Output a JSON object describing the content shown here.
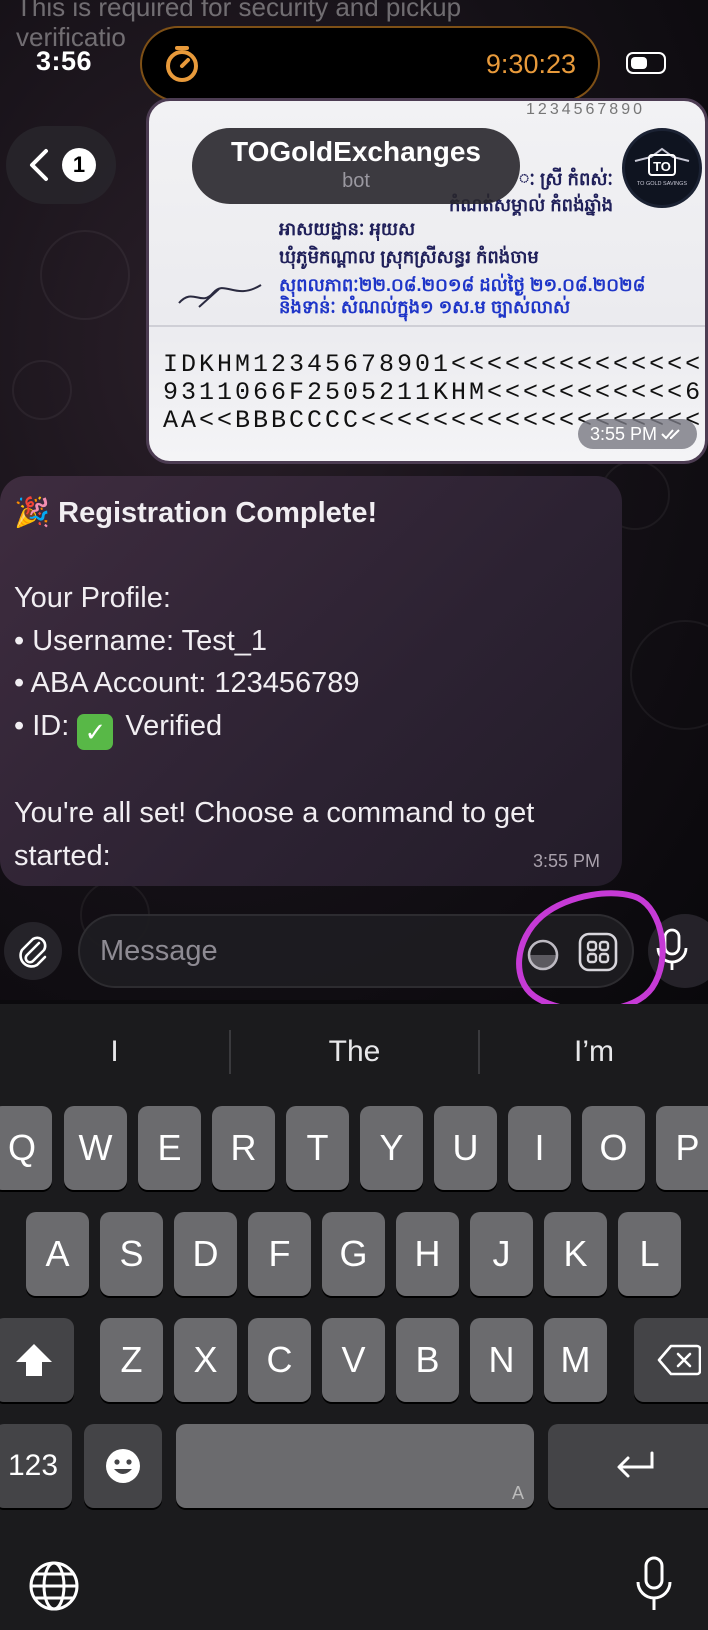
{
  "previous_message": {
    "line1": "This is required for security and pickup",
    "line2": "verificatio"
  },
  "status_bar": {
    "time": "3:56",
    "timer": "9:30:23",
    "timer_icon": "stopwatch-icon",
    "battery_icon": "battery-icon"
  },
  "header": {
    "back_badge": "1",
    "title": "TOGoldExchanges",
    "subtitle": "bot",
    "avatar_text": "TO",
    "avatar_subtext": "TO GOLD SAVINGS"
  },
  "id_card": {
    "top_number": "1234567890",
    "khmer_lines": [
      "ៈ ស្រី   កំពស់ៈ",
      "កំណត់សម្គាល់ កំពង់ឆ្នាំង",
      "អាសយដ្ឋានៈ អុយស",
      "ឃុំភូមិ​កណ្តាល ស្រុកស្រីសន្ធរ កំពង់ចាម",
      "សុពលភាពៈ២២.០៨.២០១៨ ដល់ថ្ងៃ ២១.០៨.២០២៨",
      "និងទាន់ៈ   សំណល់ក្នុង១ ១ស.ម ច្បាស់លាស់"
    ],
    "mrz": [
      "IDKHM12345678901<<<<<<<<<<<<<<",
      "9311066F2505211KHM<<<<<<<<<<<6",
      "AA<<BBBCCCC<<<<<<<<<<<<<<<<<<<"
    ],
    "time": "3:55 PM"
  },
  "bot_message": {
    "heading": "Registration Complete!",
    "profile_label": "Your Profile:",
    "username_line": "• Username: Test_1",
    "aba_line": "• ABA Account: 123456789",
    "id_prefix": "• ID:",
    "id_status": "Verified",
    "closing_line1": "You're all set! Choose a command to get",
    "closing_line2": "started:",
    "time": "3:55 PM"
  },
  "composer": {
    "placeholder": "Message"
  },
  "keyboard": {
    "suggestions": [
      "I",
      "The",
      "I’m"
    ],
    "row1": [
      "Q",
      "W",
      "E",
      "R",
      "T",
      "Y",
      "U",
      "I",
      "O",
      "P"
    ],
    "row2": [
      "A",
      "S",
      "D",
      "F",
      "G",
      "H",
      "J",
      "K",
      "L"
    ],
    "row3": [
      "Z",
      "X",
      "C",
      "V",
      "B",
      "N",
      "M"
    ],
    "numbers_key": "123",
    "space_hint": "A"
  },
  "colors": {
    "accent_orange": "#e89a3b",
    "annotation_magenta": "#c63ad6",
    "verified_green": "#58b847"
  }
}
